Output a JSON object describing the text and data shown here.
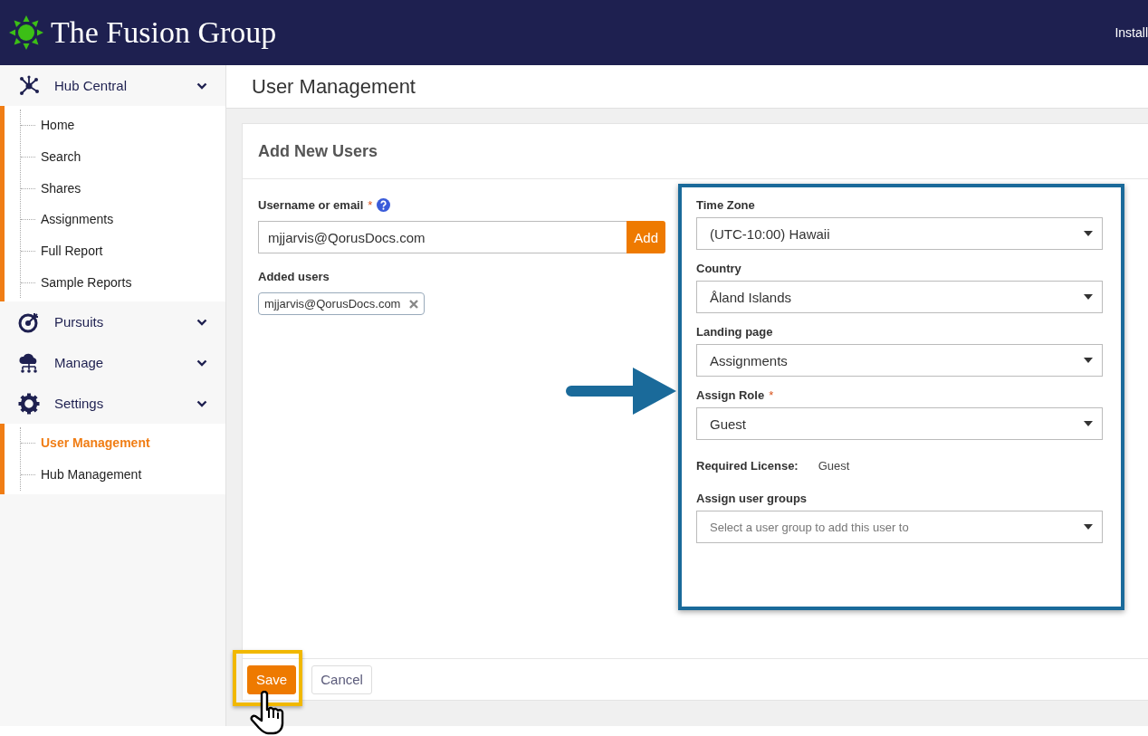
{
  "header": {
    "brand": "The Fusion Group",
    "action": "Install"
  },
  "sidebar": [
    {
      "label": "Hub Central",
      "expanded": true,
      "children": [
        {
          "label": "Home",
          "selected": false
        },
        {
          "label": "Search",
          "selected": false
        },
        {
          "label": "Shares",
          "selected": false
        },
        {
          "label": "Assignments",
          "selected": false
        },
        {
          "label": "Full Report",
          "selected": false
        },
        {
          "label": "Sample Reports",
          "selected": false
        }
      ]
    },
    {
      "label": "Pursuits"
    },
    {
      "label": "Manage"
    },
    {
      "label": "Settings",
      "expanded": true,
      "children": [
        {
          "label": "User Management",
          "selected": true
        },
        {
          "label": "Hub Management",
          "selected": false
        }
      ]
    }
  ],
  "page_title": "User Management",
  "card": {
    "title": "Add New Users",
    "username": {
      "label": "Username or email",
      "mark": "*",
      "value": "mjjarvis@QorusDocs.com",
      "button": "Add"
    },
    "added": {
      "label": "Added users",
      "tags": [
        "mjjarvis@QorusDocs.com"
      ]
    },
    "fields": [
      {
        "kind": "select",
        "label": "Time Zone",
        "value": "(UTC-10:00) Hawaii"
      },
      {
        "kind": "select",
        "label": "Country",
        "value": "Åland Islands"
      },
      {
        "kind": "select",
        "label": "Landing page",
        "value": "Assignments"
      },
      {
        "kind": "select",
        "label": "Assign Role",
        "mark": "*",
        "value": "Guest"
      },
      {
        "kind": "info",
        "label": "Required License:",
        "value": "Guest"
      },
      {
        "kind": "select",
        "label": "Assign user groups",
        "placeholder": "Select a user group to add this user to"
      }
    ],
    "buttons": [
      {
        "label": "Save",
        "kind": "primary"
      },
      {
        "label": "Cancel",
        "kind": "secondary"
      }
    ]
  }
}
